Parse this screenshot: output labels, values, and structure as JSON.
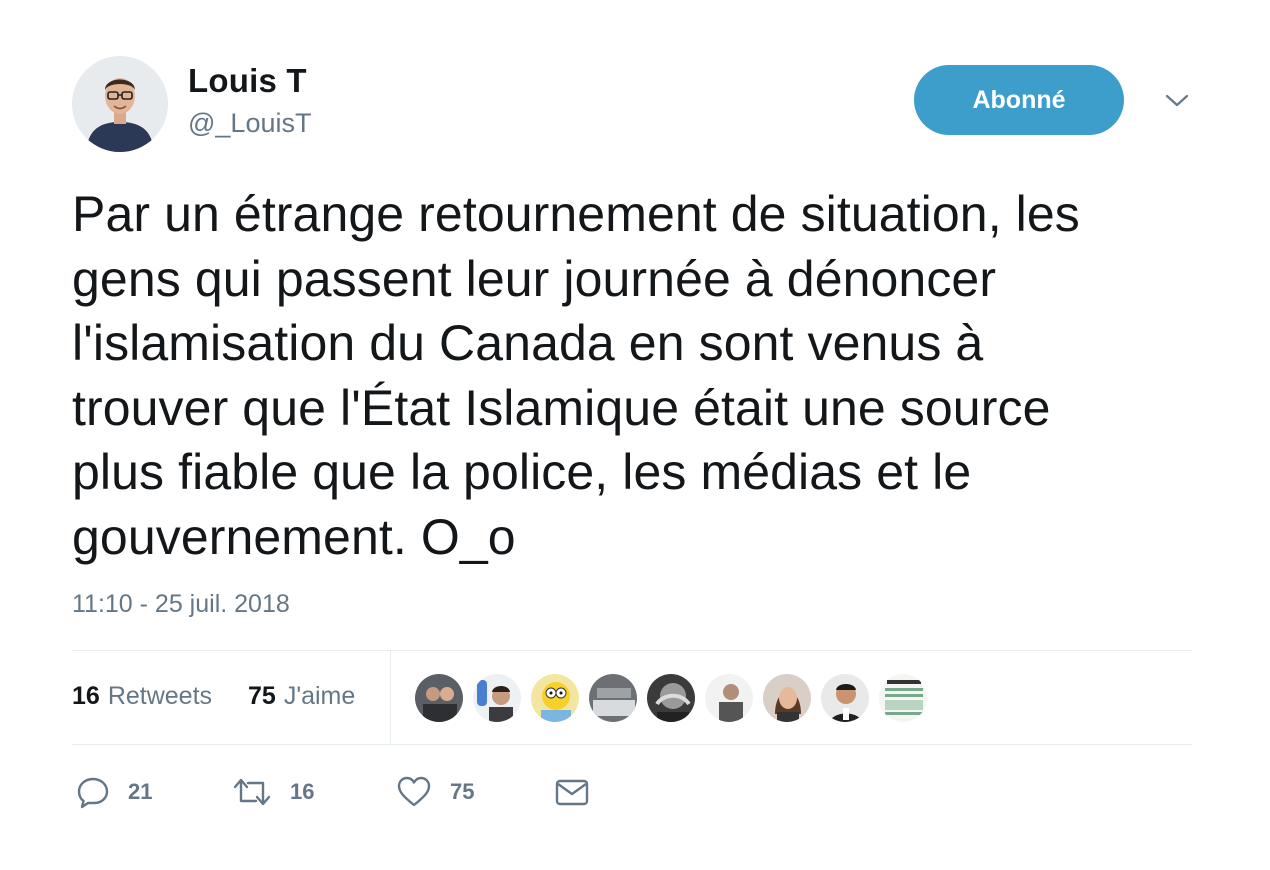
{
  "author": {
    "display_name": "Louis T",
    "handle": "@_LouisT",
    "avatar_icon": "profile-photo"
  },
  "follow_button": {
    "label": "Abonné",
    "color": "#3d9ecb"
  },
  "menu": {
    "icon": "chevron-down-icon"
  },
  "tweet": {
    "text": "Par un étrange retournement de situation, les\ngens qui passent leur journée à dénoncer\nl'islamisation du Canada en sont venus à\ntrouver que l'État Islamique était une source\nplus fiable que la police, les médias et le\ngouvernement. O_o",
    "timestamp": "11:10 - 25 juil. 2018"
  },
  "stats": {
    "retweets": {
      "count": "16",
      "label": "Retweets"
    },
    "likes": {
      "count": "75",
      "label": "J'aime"
    }
  },
  "likers": [
    {
      "name": "liker-avatar-1"
    },
    {
      "name": "liker-avatar-2"
    },
    {
      "name": "liker-avatar-3"
    },
    {
      "name": "liker-avatar-4"
    },
    {
      "name": "liker-avatar-5"
    },
    {
      "name": "liker-avatar-6"
    },
    {
      "name": "liker-avatar-7"
    },
    {
      "name": "liker-avatar-8"
    },
    {
      "name": "liker-avatar-9"
    }
  ],
  "actions": {
    "reply": {
      "icon": "reply-icon",
      "count": "21"
    },
    "retweet": {
      "icon": "retweet-icon",
      "count": "16"
    },
    "like": {
      "icon": "heart-icon",
      "count": "75"
    },
    "dm": {
      "icon": "mail-icon"
    }
  }
}
